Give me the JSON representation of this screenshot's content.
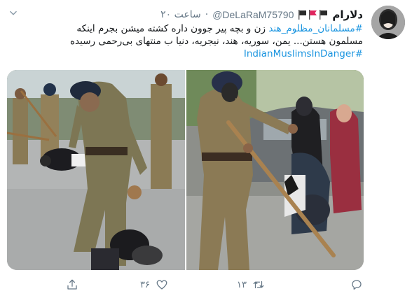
{
  "tweet": {
    "display_name": "دلارام",
    "handle": "@DeLaRaM75790",
    "separator": "·",
    "time": "۲۰ ساعت",
    "text": {
      "line1_hashtag": "#مسلمانان_مظلوم_هند",
      "line1_text": " زن و بچه پیر جوون داره کشته میشن بجرم اینکه",
      "line2": "مسلمون هستن... یمن، سوریه، هند، نیجریه، دنیا ب منتهای بی‌رحمی رسیده",
      "line3_hashtag": "#IndianMuslimsInDanger"
    },
    "flag_icons": [
      "black-flag-icon",
      "red-flag-icon",
      "black-flag-icon"
    ],
    "media": {
      "left_photo": "police-officer-photo-left",
      "right_photo": "police-officer-photo-right"
    }
  },
  "actions": {
    "reply": {
      "icon": "reply-icon",
      "count": ""
    },
    "retweet": {
      "icon": "retweet-icon",
      "count": "۱۳"
    },
    "like": {
      "icon": "heart-icon",
      "count": "۳۶"
    },
    "share": {
      "icon": "share-icon",
      "count": ""
    }
  },
  "colors": {
    "link": "#1b95e0",
    "muted": "#657786",
    "text": "#14171a"
  }
}
